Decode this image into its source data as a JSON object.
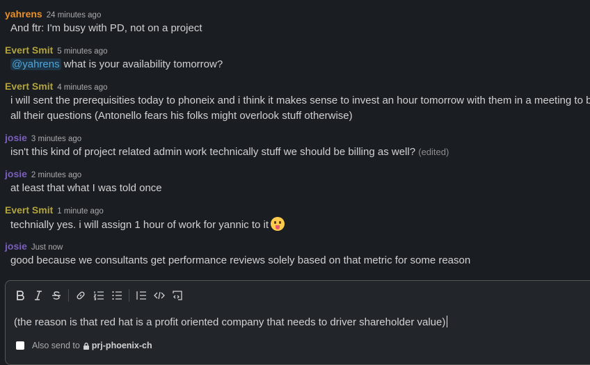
{
  "colors": {
    "background": "#1a1d21",
    "author_yahrens": "#e8912d",
    "author_evert": "#b3a53a",
    "author_josie": "#7b5ebf",
    "mention": "#4fa6d8"
  },
  "messages": [
    {
      "author": "yahrens",
      "time": "24 minutes ago",
      "text": "And ftr: I'm busy with PD, not on a project"
    },
    {
      "author": "Evert Smit",
      "time": "5 minutes ago",
      "mention": "@yahrens",
      "text": " what is your availability tomorrow?"
    },
    {
      "author": "Evert Smit",
      "time": "4 minutes ago",
      "text": "i will sent the prerequisities today to phoneix and i think it makes sense to invest an hour tomorrow with them in a meeting to b",
      "text2": "all their questions (Antonello fears his folks might overlook stuff otherwise)"
    },
    {
      "author": "josie",
      "time": "3 minutes ago",
      "text": "isn't this kind of project related admin work technically stuff we should be billing as well?",
      "edited": "(edited)"
    },
    {
      "author": "josie",
      "time": "2 minutes ago",
      "text": "at least that what I was told once"
    },
    {
      "author": "Evert Smit",
      "time": "1 minute ago",
      "text": "technially yes. i will assign 1 hour of work for yannic to it",
      "emoji": "stuck-out-tongue-winking-eye"
    },
    {
      "author": "josie",
      "time": "Just now",
      "text": "good because we consultants get performance reviews solely based on that metric for some reason"
    }
  ],
  "composer": {
    "toolbar_icons": [
      "bold-icon",
      "italic-icon",
      "strikethrough-icon",
      "link-icon",
      "ordered-list-icon",
      "bulleted-list-icon",
      "blockquote-icon",
      "code-icon",
      "code-block-icon"
    ],
    "draft_text": "(the reason is that red hat is a profit oriented company that needs to driver shareholder value)",
    "also_send_label": "Also send to",
    "channel_name": "prj-phoenix-ch",
    "also_send_checked": false
  }
}
